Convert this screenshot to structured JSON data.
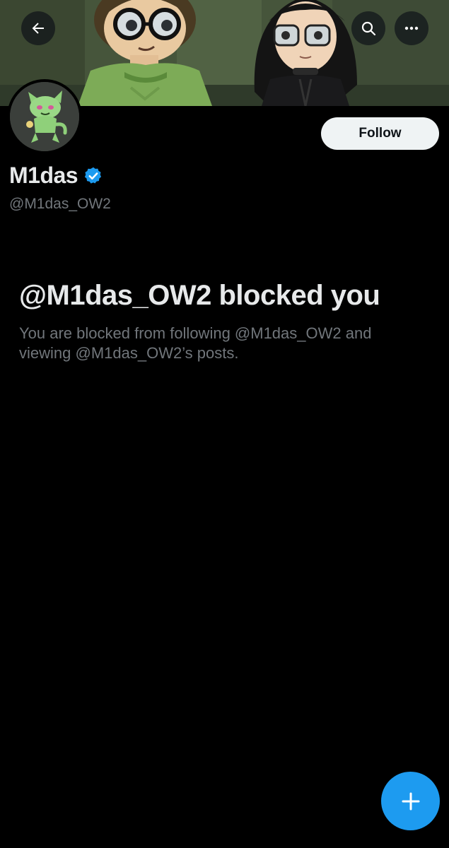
{
  "header": {
    "back_icon": "arrow-left-icon",
    "search_icon": "search-icon",
    "more_icon": "more-horizontal-icon"
  },
  "profile": {
    "display_name": "M1das",
    "verified": true,
    "handle": "@M1das_OW2",
    "follow_label": "Follow"
  },
  "blocked": {
    "title": "@M1das_OW2 blocked you",
    "description": "You are blocked from following @M1das_OW2 and viewing @M1das_OW2’s posts."
  },
  "fab": {
    "icon": "plus-icon"
  },
  "colors": {
    "background": "#000000",
    "accent": "#1d9bf0",
    "text_primary": "#e7e9ea",
    "text_secondary": "#71767b",
    "follow_bg": "#eff3f4"
  }
}
